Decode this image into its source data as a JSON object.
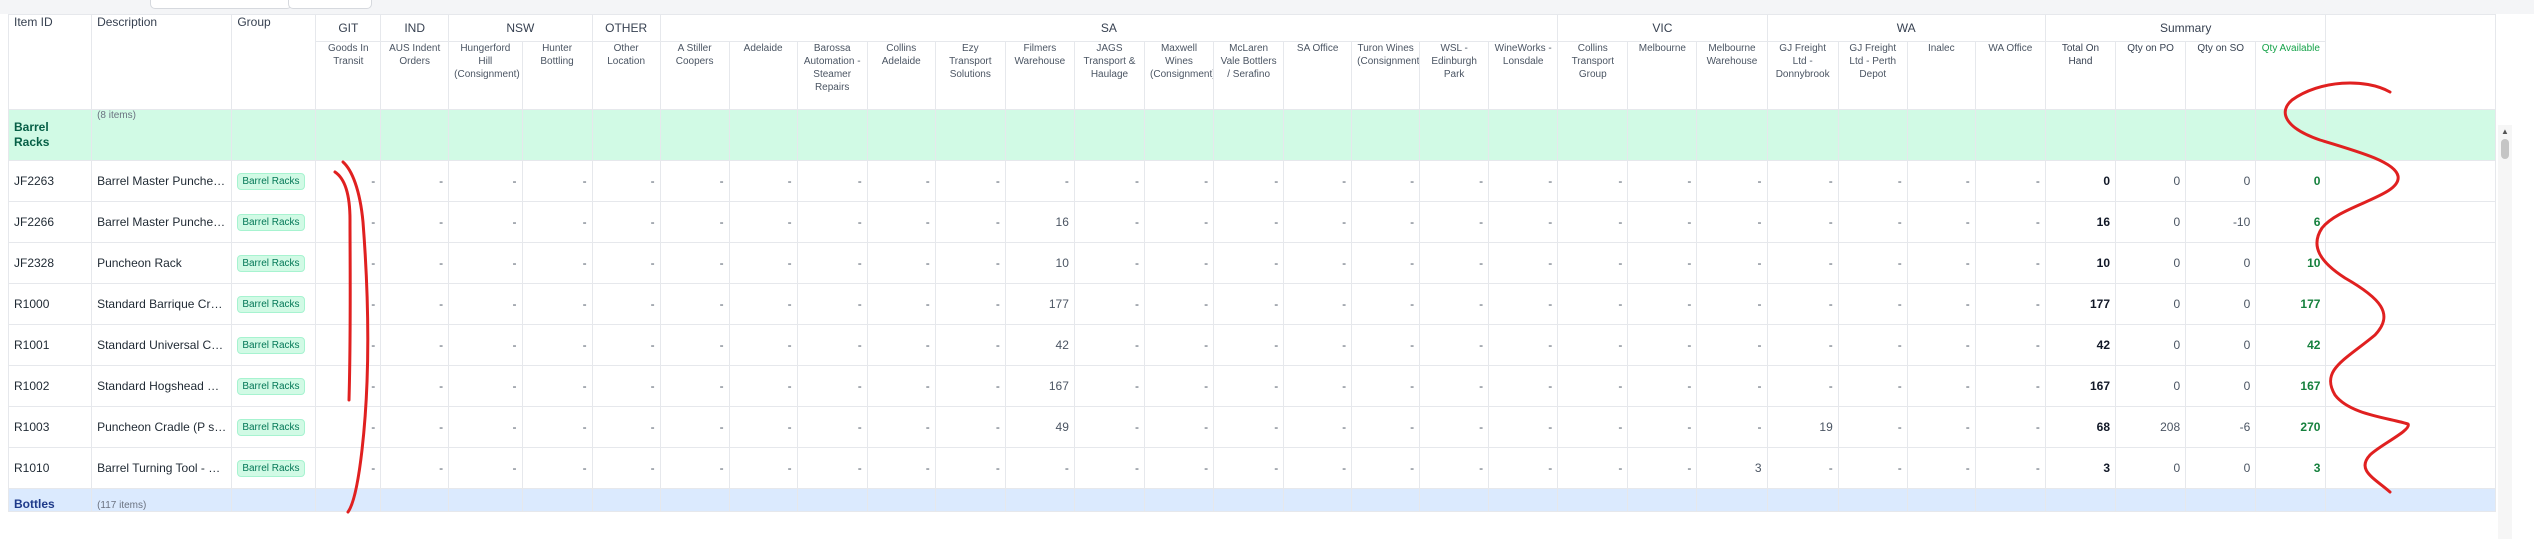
{
  "header": {
    "item_id": "Item ID",
    "description": "Description",
    "group": "Group",
    "regions": [
      {
        "name": "GIT",
        "span": 1
      },
      {
        "name": "IND",
        "span": 1
      },
      {
        "name": "NSW",
        "span": 2
      },
      {
        "name": "OTHER",
        "span": 1
      },
      {
        "name": "SA",
        "span": 13
      },
      {
        "name": "VIC",
        "span": 3
      },
      {
        "name": "WA",
        "span": 4
      },
      {
        "name": "Summary",
        "span": 4
      }
    ],
    "locations": [
      "Goods In Transit",
      "AUS Indent Orders",
      "Hungerford Hill (Consignment)",
      "Hunter Bottling",
      "Other Location",
      "A Stiller Coopers",
      "Adelaide",
      "Barossa Automation - Steamer Repairs",
      "Collins Adelaide",
      "Ezy Transport Solutions",
      "Filmers Warehouse",
      "JAGS Transport & Haulage",
      "Maxwell Wines (Consignment)",
      "McLaren Vale Bottlers / Serafino",
      "SA Office",
      "Turon Wines (Consignment)",
      "WSL - Edinburgh Park",
      "WineWorks - Lonsdale",
      "Collins Transport Group",
      "Melbourne",
      "Melbourne Warehouse",
      "GJ Freight Ltd - Donnybrook",
      "GJ Freight Ltd - Perth Depot",
      "Inalec",
      "WA Office"
    ],
    "summary": [
      "Total On Hand",
      "Qty on PO",
      "Qty on SO",
      "Qty Available"
    ]
  },
  "sections": [
    {
      "name": "Barrel Racks",
      "count": "(8 items)"
    },
    {
      "name": "Bottles",
      "count": "(117 items)"
    }
  ],
  "rows": [
    {
      "id": "JF2263",
      "description": "Barrel Master Puncheon Pre ...",
      "group": "Barrel Racks",
      "locations": [
        "-",
        "-",
        "-",
        "-",
        "-",
        "-",
        "-",
        "-",
        "-",
        "-",
        "-",
        "-",
        "-",
        "-",
        "-",
        "-",
        "-",
        "-",
        "-",
        "-",
        "-",
        "-",
        "-",
        "-",
        "-"
      ],
      "total": "0",
      "po": "0",
      "so": "0",
      "available": "0"
    },
    {
      "id": "JF2266",
      "description": "Barrel Master Puncheon Hot ...",
      "group": "Barrel Racks",
      "locations": [
        "-",
        "-",
        "-",
        "-",
        "-",
        "-",
        "-",
        "-",
        "-",
        "-",
        "16",
        "-",
        "-",
        "-",
        "-",
        "-",
        "-",
        "-",
        "-",
        "-",
        "-",
        "-",
        "-",
        "-",
        "-"
      ],
      "total": "16",
      "po": "0",
      "so": "-10",
      "available": "6"
    },
    {
      "id": "JF2328",
      "description": "Puncheon Rack",
      "group": "Barrel Racks",
      "locations": [
        "-",
        "-",
        "-",
        "-",
        "-",
        "-",
        "-",
        "-",
        "-",
        "-",
        "10",
        "-",
        "-",
        "-",
        "-",
        "-",
        "-",
        "-",
        "-",
        "-",
        "-",
        "-",
        "-",
        "-",
        "-"
      ],
      "total": "10",
      "po": "0",
      "so": "0",
      "available": "10"
    },
    {
      "id": "R1000",
      "description": "Standard Barrique Cradle (B ...",
      "group": "Barrel Racks",
      "locations": [
        "-",
        "-",
        "-",
        "-",
        "-",
        "-",
        "-",
        "-",
        "-",
        "-",
        "177",
        "-",
        "-",
        "-",
        "-",
        "-",
        "-",
        "-",
        "-",
        "-",
        "-",
        "-",
        "-",
        "-",
        "-"
      ],
      "total": "177",
      "po": "0",
      "so": "0",
      "available": "177"
    },
    {
      "id": "R1001",
      "description": "Standard Universal Cradle (U...",
      "group": "Barrel Racks",
      "locations": [
        "-",
        "-",
        "-",
        "-",
        "-",
        "-",
        "-",
        "-",
        "-",
        "-",
        "42",
        "-",
        "-",
        "-",
        "-",
        "-",
        "-",
        "-",
        "-",
        "-",
        "-",
        "-",
        "-",
        "-",
        "-"
      ],
      "total": "42",
      "po": "0",
      "so": "0",
      "available": "42"
    },
    {
      "id": "R1002",
      "description": "Standard Hogshead Cradle (...",
      "group": "Barrel Racks",
      "locations": [
        "-",
        "-",
        "-",
        "-",
        "-",
        "-",
        "-",
        "-",
        "-",
        "-",
        "167",
        "-",
        "-",
        "-",
        "-",
        "-",
        "-",
        "-",
        "-",
        "-",
        "-",
        "-",
        "-",
        "-",
        "-"
      ],
      "total": "167",
      "po": "0",
      "so": "0",
      "available": "167"
    },
    {
      "id": "R1003",
      "description": "Puncheon Cradle (P size)",
      "group": "Barrel Racks",
      "locations": [
        "-",
        "-",
        "-",
        "-",
        "-",
        "-",
        "-",
        "-",
        "-",
        "-",
        "49",
        "-",
        "-",
        "-",
        "-",
        "-",
        "-",
        "-",
        "-",
        "-",
        "-",
        "19",
        "-",
        "-",
        "-"
      ],
      "total": "68",
      "po": "208",
      "so": "-6",
      "available": "270"
    },
    {
      "id": "R1010",
      "description": "Barrel Turning Tool - Stainles...",
      "group": "Barrel Racks",
      "locations": [
        "-",
        "-",
        "-",
        "-",
        "-",
        "-",
        "-",
        "-",
        "-",
        "-",
        "-",
        "-",
        "-",
        "-",
        "-",
        "-",
        "-",
        "-",
        "-",
        "-",
        "3",
        "-",
        "-",
        "-",
        "-"
      ],
      "total": "3",
      "po": "0",
      "so": "0",
      "available": "3"
    }
  ],
  "colors": {
    "section_green": "#d1fae5",
    "section_blue": "#dbeafe",
    "available_green": "#15803d",
    "annotation_red": "#e02020"
  }
}
